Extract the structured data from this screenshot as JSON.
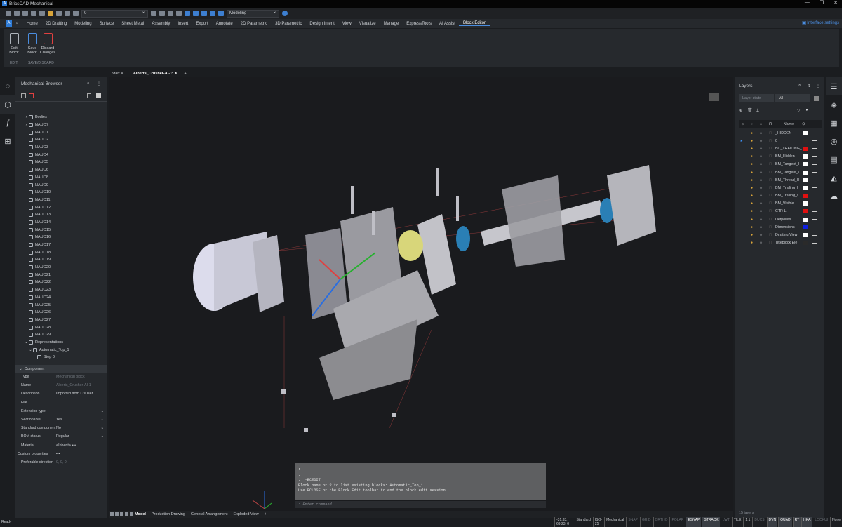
{
  "app": {
    "title": "BricsCAD Mechanical",
    "window_controls": [
      "—",
      "❐",
      "✕"
    ]
  },
  "qat": {
    "layer_value": "0",
    "workspace": "Modeling"
  },
  "ribbon": {
    "tabs": [
      "Home",
      "2D Drafting",
      "Modeling",
      "Surface",
      "Sheet Metal",
      "Assembly",
      "Insert",
      "Export",
      "Annotate",
      "2D Parametric",
      "3D Parametric",
      "Design Intent",
      "View",
      "Visualize",
      "Manage",
      "ExpressTools",
      "AI Assist",
      "Block Editor"
    ],
    "active_tab": "Block Editor",
    "interface_settings": "Interface settings",
    "buttons": [
      {
        "label": "Edit\nBlock",
        "l1": "Edit",
        "l2": "Block"
      },
      {
        "l1": "Save",
        "l2": "Block"
      },
      {
        "l1": "Discard",
        "l2": "Changes"
      }
    ],
    "groups": [
      "EDIT",
      "SAVE/DISCARD"
    ]
  },
  "doc_tabs": [
    {
      "label": "Start",
      "close": "X"
    },
    {
      "label": "Alberts_Crusher-AI-1*",
      "close": "X"
    }
  ],
  "doc_tab_add": "+",
  "browser": {
    "title": "Mechanical Browser",
    "tree": [
      {
        "label": "Bodies",
        "arrow": "›",
        "type": "folder",
        "indent": 1
      },
      {
        "label": "NAUO7",
        "arrow": "›",
        "indent": 1
      },
      {
        "label": "NAUO1",
        "indent": 1
      },
      {
        "label": "NAUO2",
        "indent": 1
      },
      {
        "label": "NAUO3",
        "indent": 1
      },
      {
        "label": "NAUO4",
        "indent": 1
      },
      {
        "label": "NAUO5",
        "indent": 1
      },
      {
        "label": "NAUO6",
        "indent": 1
      },
      {
        "label": "NAUO8",
        "indent": 1
      },
      {
        "label": "NAUO9",
        "indent": 1
      },
      {
        "label": "NAUO10",
        "indent": 1
      },
      {
        "label": "NAUO11",
        "indent": 1
      },
      {
        "label": "NAUO12",
        "indent": 1
      },
      {
        "label": "NAUO13",
        "indent": 1
      },
      {
        "label": "NAUO14",
        "indent": 1
      },
      {
        "label": "NAUO15",
        "indent": 1
      },
      {
        "label": "NAUO16",
        "indent": 1
      },
      {
        "label": "NAUO17",
        "indent": 1
      },
      {
        "label": "NAUO18",
        "indent": 1
      },
      {
        "label": "NAUO19",
        "indent": 1
      },
      {
        "label": "NAUO20",
        "indent": 1
      },
      {
        "label": "NAUO21",
        "indent": 1
      },
      {
        "label": "NAUO22",
        "indent": 1
      },
      {
        "label": "NAUO23",
        "indent": 1
      },
      {
        "label": "NAUO24",
        "indent": 1
      },
      {
        "label": "NAUO25",
        "indent": 1
      },
      {
        "label": "NAUO26",
        "indent": 1
      },
      {
        "label": "NAUO27",
        "indent": 1
      },
      {
        "label": "NAUO28",
        "indent": 1
      },
      {
        "label": "NAUO29",
        "indent": 1
      },
      {
        "label": "Representations",
        "arrow": "⌄",
        "type": "folder",
        "indent": 1
      },
      {
        "label": "Automatic_Top_1",
        "arrow": "⌄",
        "indent": 2
      },
      {
        "label": "Step 0",
        "indent": 3
      }
    ],
    "section": "Component",
    "properties": [
      {
        "k": "Type",
        "v": "Mechanical block",
        "dim": true
      },
      {
        "k": "Name",
        "v": "Alberts_Crusher-AI-1",
        "dim": true
      },
      {
        "k": "Description",
        "v": "Imported from C:\\User"
      },
      {
        "k": "File",
        "v": ""
      },
      {
        "k": "Extension type",
        "v": "",
        "dd": true
      },
      {
        "k": "Sectionable",
        "v": "Yes",
        "dd": true
      },
      {
        "k": "Standard component",
        "v": "No",
        "dd": true
      },
      {
        "k": "BOM status",
        "v": "Regular",
        "dd": true
      },
      {
        "k": "Material",
        "v": "<Inherit>   •••"
      },
      {
        "k": "Custom properties",
        "v": "•••",
        "arrow": true
      },
      {
        "k": "Preferable direction",
        "v": "0, 0, 0",
        "dim": true
      }
    ]
  },
  "command": {
    "history": ":\n:\n: _-BCEDIT\nBlock name or ? to list existing blocks: Automatic_Top_1\nUse BCLOSE or the Block Edit toolbar to end the block edit session.",
    "placeholder": ": Enter command"
  },
  "layout_tabs": [
    "Model",
    "Production Drawing",
    "General Arrangement",
    "Exploded View",
    "+"
  ],
  "layers": {
    "title": "Layers",
    "layer_state": "Layer state",
    "filter": "All",
    "name_header": "Name",
    "footer": "15 layers",
    "rows": [
      {
        "name": "_HIDDEN",
        "color": "#ffffff"
      },
      {
        "name": "0",
        "color": "#2a2a2a",
        "current": true
      },
      {
        "name": "BC_TRAILING_",
        "color": "#e01010"
      },
      {
        "name": "BM_Hidden",
        "color": "#ffffff"
      },
      {
        "name": "BM_Tangent_I",
        "color": "#ffffff"
      },
      {
        "name": "BM_Tangent_\\",
        "color": "#ffffff"
      },
      {
        "name": "BM_Thread_H",
        "color": "#ffffff"
      },
      {
        "name": "BM_Trailing_I",
        "color": "#ffffff"
      },
      {
        "name": "BM_Trailing_\\",
        "color": "#e01010"
      },
      {
        "name": "BM_Visible",
        "color": "#ffffff"
      },
      {
        "name": "CTR-L",
        "color": "#e01010"
      },
      {
        "name": "Defpoints",
        "color": "#ffffff"
      },
      {
        "name": "Dimensions",
        "color": "#1020e0"
      },
      {
        "name": "Drafting View",
        "color": "#ffffff"
      },
      {
        "name": "Titleblock Ele",
        "color": "#2a2a2a"
      }
    ]
  },
  "status": {
    "ready": "Ready",
    "coords": "-31.33, 69.23, 0",
    "items": [
      {
        "t": "Standard",
        "s": ""
      },
      {
        "t": "ISO-25",
        "s": ""
      },
      {
        "t": "Mechanical",
        "s": ""
      },
      {
        "t": "SNAP",
        "s": "off"
      },
      {
        "t": "GRID",
        "s": "off"
      },
      {
        "t": "ORTHO",
        "s": "off"
      },
      {
        "t": "POLAR",
        "s": "off"
      },
      {
        "t": "ESNAP",
        "s": "on"
      },
      {
        "t": "STRACK",
        "s": "on"
      },
      {
        "t": "LWT",
        "s": "off"
      },
      {
        "t": "TILE",
        "s": ""
      },
      {
        "t": "1:1",
        "s": ""
      },
      {
        "t": "DUCS",
        "s": "off"
      },
      {
        "t": "DYN",
        "s": "on"
      },
      {
        "t": "QUAD",
        "s": "on"
      },
      {
        "t": "RT",
        "s": "on"
      },
      {
        "t": "HKA",
        "s": "on"
      },
      {
        "t": "LOCKUI",
        "s": "off"
      },
      {
        "t": "None",
        "s": ""
      }
    ]
  },
  "colors": {
    "accent": "#4a8de0",
    "panel": "#26292d",
    "viewport": "#1a1b1e"
  }
}
